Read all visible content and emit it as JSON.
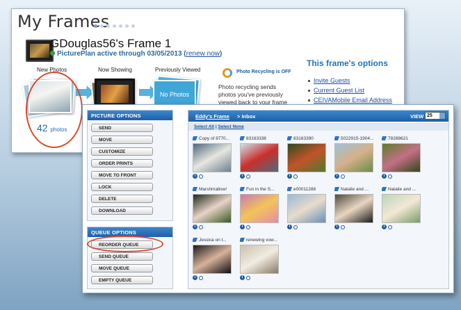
{
  "app": {
    "title": "My Frames",
    "frame_name": "GDouglas56's Frame 1",
    "plan_text": "PicturePlan active through 03/05/2013",
    "renew_label": "renew now"
  },
  "states": {
    "new_photos_label": "New Photos",
    "now_showing_label": "Now Showing",
    "previously_viewed_label": "Previously Viewed",
    "no_photos_text": "No Photos",
    "photo_count": "42",
    "photo_count_unit": "photos"
  },
  "recycling": {
    "status": "Photo Recycling is OFF",
    "description": "Photo recycling sends photos you've previously viewed back to your frame again. They"
  },
  "frame_options": {
    "title": "This frame's options",
    "links": [
      "Invite Guests",
      "Current Guest List",
      "CEIVAMobile Email Address"
    ]
  },
  "picture_options": {
    "header": "PICTURE OPTIONS",
    "buttons": [
      "SEND",
      "MOVE",
      "CUSTOMIZE",
      "ORDER PRINTS",
      "MOVE TO FRONT",
      "LOCK",
      "DELETE",
      "DOWNLOAD"
    ]
  },
  "queue_options": {
    "header": "QUEUE OPTIONS",
    "buttons": [
      "REORDER QUEUE",
      "SEND QUEUE",
      "MOVE QUEUE",
      "EMPTY QUEUE"
    ]
  },
  "inbox": {
    "frame_link": "Eddy's Frame",
    "folder": "> Inbox",
    "view_label": "VIEW",
    "view_value": "25",
    "select_all": "Select All",
    "separator": "|",
    "select_none": "Select None"
  },
  "photos": [
    {
      "caption": "Copy of 8770...",
      "colors": [
        "#4b6a80",
        "#e8e6df",
        "#6d8090"
      ]
    },
    {
      "caption": "83163338",
      "colors": [
        "#cfe0ea",
        "#c9302c",
        "#4d6b7b"
      ]
    },
    {
      "caption": "83163390",
      "colors": [
        "#2e4a1c",
        "#c2532a",
        "#4e7a2d"
      ]
    },
    {
      "caption": "5022915-1904...",
      "colors": [
        "#9ec2d6",
        "#d6b08a",
        "#6a8d4a"
      ]
    },
    {
      "caption": "78288621",
      "colors": [
        "#5c7f2a",
        "#c46f86",
        "#2f4a1a"
      ]
    },
    {
      "caption": "Marshmallow!",
      "colors": [
        "#1e2a16",
        "#e8d3c8",
        "#3a5a22"
      ]
    },
    {
      "caption": "Fun in the S...",
      "colors": [
        "#c97ab0",
        "#f2c45a",
        "#e88aa8"
      ]
    },
    {
      "caption": "e00011288",
      "colors": [
        "#9ab8d8",
        "#e7dccb",
        "#6a8fb8"
      ]
    },
    {
      "caption": "Natalie and ...",
      "colors": [
        "#4d4a3c",
        "#e9d6c2",
        "#1c1c18"
      ]
    },
    {
      "caption": "Natalie and ...",
      "colors": [
        "#bcd6b8",
        "#f3e8d5",
        "#7a9c6a"
      ]
    },
    {
      "caption": "Jessica on t...",
      "colors": [
        "#1c1c1c",
        "#d8b29a",
        "#0f0f0f"
      ]
    },
    {
      "caption": "renewing vow...",
      "colors": [
        "#c9c1b0",
        "#f1ece2",
        "#8a7c66"
      ]
    }
  ]
}
